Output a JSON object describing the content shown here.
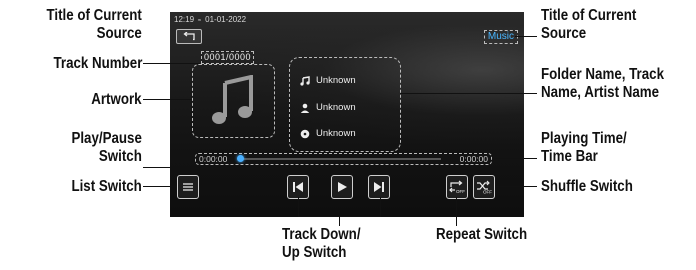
{
  "screen": {
    "status_time": "12:19",
    "status_date": "01-01-2022",
    "source_label": "Music",
    "track_number": "0001/0000",
    "folder_name": "Unknown",
    "track_name": "Unknown",
    "artist_name": "Unknown",
    "elapsed_time": "0:00:00",
    "total_time": "0:00:00",
    "progress": 0.0
  },
  "callouts": {
    "title_left_1": "Title of Current",
    "title_left_2": "Source",
    "track_number": "Track Number",
    "artwork": "Artwork",
    "play_pause_1": "Play/Pause",
    "play_pause_2": "Switch",
    "list_switch": "List Switch",
    "title_right_1": "Title of Current",
    "title_right_2": "Source",
    "folder_1": "Folder Name, Track",
    "folder_2": "Name, Artist Name",
    "playing_time_1": "Playing Time/",
    "playing_time_2": "Time Bar",
    "shuffle": "Shuffle Switch",
    "track_down_1": "Track Down/",
    "track_down_2": "Up Switch",
    "repeat": "Repeat Switch"
  }
}
